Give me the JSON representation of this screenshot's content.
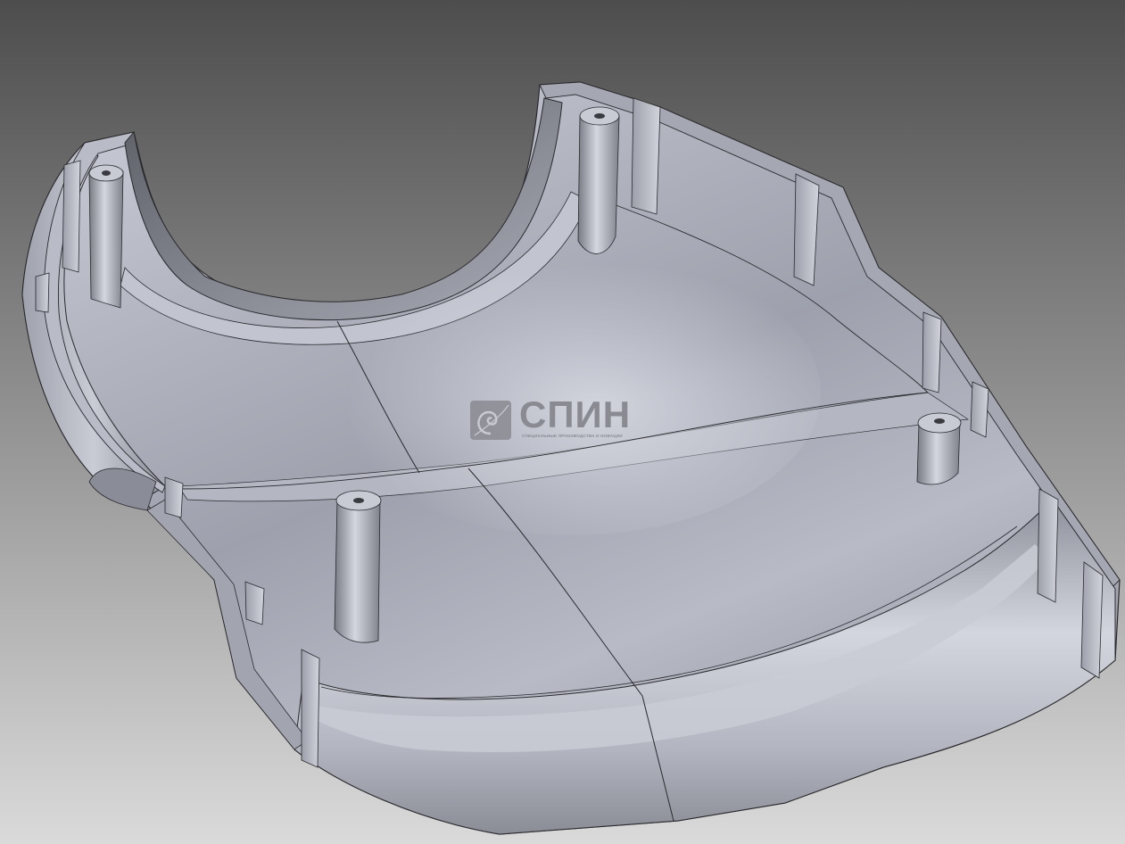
{
  "colors": {
    "background_top": "#4f4f4f",
    "background_bottom": "#d6d6d6",
    "part_light": "#c9cbd6",
    "part_mid": "#a4a7b3",
    "part_dark": "#6e7079",
    "edge_line": "#2a2a2e",
    "watermark": "#8a8a92"
  },
  "watermark": {
    "title": "СПИН",
    "subtitle": "СПЕЦИАЛЬНЫЕ ПРОИЗВОДСТВА И НОВАЦИИ",
    "logo_icon": "swirl-logo-icon"
  }
}
